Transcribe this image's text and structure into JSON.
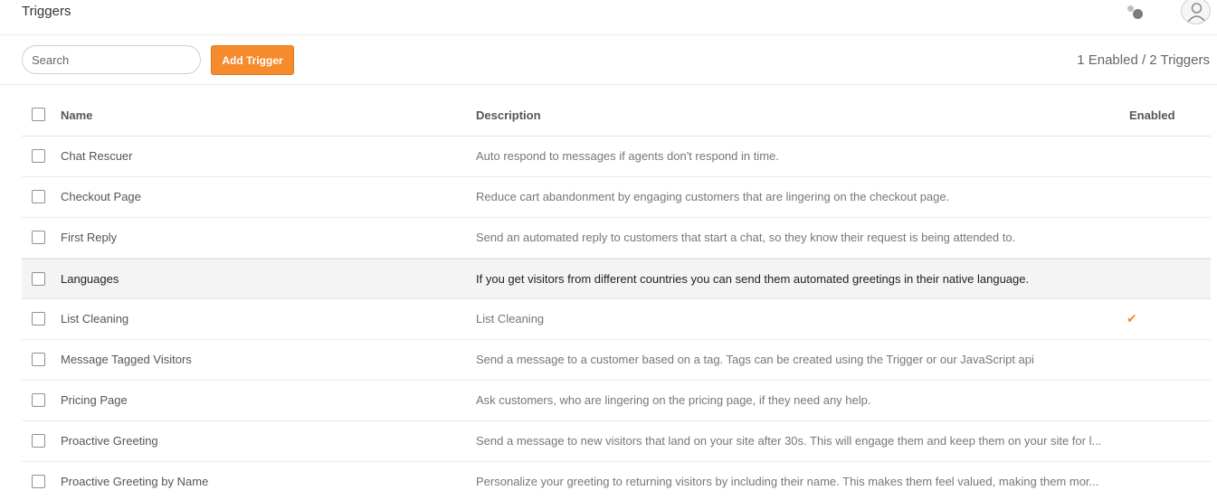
{
  "header": {
    "title": "Triggers"
  },
  "toolbar": {
    "search_placeholder": "Search",
    "add_label": "Add Trigger",
    "count_text": "1 Enabled / 2 Triggers"
  },
  "colors": {
    "accent": "#f68b2e"
  },
  "table": {
    "columns": {
      "name": "Name",
      "description": "Description",
      "enabled": "Enabled"
    },
    "enabled_icon": "✔",
    "rows": [
      {
        "name": "Chat Rescuer",
        "description": "Auto respond to messages if agents don't respond in time.",
        "enabled": false
      },
      {
        "name": "Checkout Page",
        "description": "Reduce cart abandonment by engaging customers that are lingering on the checkout page.",
        "enabled": false
      },
      {
        "name": "First Reply",
        "description": "Send an automated reply to customers that start a chat, so they know their request is being attended to.",
        "enabled": false
      },
      {
        "name": "Languages",
        "description": "If you get visitors from different countries you can send them automated greetings in their native language.",
        "enabled": false
      },
      {
        "name": "List Cleaning",
        "description": "List Cleaning",
        "enabled": true
      },
      {
        "name": "Message Tagged Visitors",
        "description": "Send a message to a customer based on a tag. Tags can be created using the Trigger or our JavaScript api",
        "enabled": false
      },
      {
        "name": "Pricing Page",
        "description": "Ask customers, who are lingering on the pricing page, if they need any help.",
        "enabled": false
      },
      {
        "name": "Proactive Greeting",
        "description": "Send a message to new visitors that land on your site after 30s. This will engage them and keep them on your site for l...",
        "enabled": false
      },
      {
        "name": "Proactive Greeting by Name",
        "description": "Personalize your greeting to returning visitors by including their name. This makes them feel valued, making them mor...",
        "enabled": false
      }
    ]
  }
}
